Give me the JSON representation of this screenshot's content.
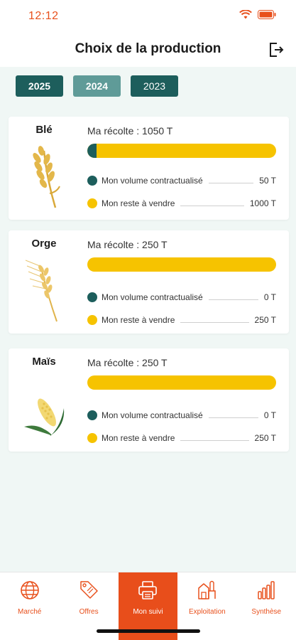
{
  "status": {
    "time": "12:12"
  },
  "header": {
    "title": "Choix de la production",
    "logout_icon": "logout-icon"
  },
  "years": [
    {
      "label": "2025",
      "active": true
    },
    {
      "label": "2024",
      "active": false
    },
    {
      "label": "2023",
      "active": false
    }
  ],
  "crops": [
    {
      "name": "Blé",
      "harvest": "Ma récolte : 1050 T",
      "contracted_label": "Mon volume contractualisé",
      "contracted_value": "50 T",
      "remaining_label": "Mon reste à vendre",
      "remaining_value": "1000 T",
      "contracted_fraction": 0.048,
      "icon": "wheat-icon"
    },
    {
      "name": "Orge",
      "harvest": "Ma récolte : 250 T",
      "contracted_label": "Mon volume contractualisé",
      "contracted_value": "0 T",
      "remaining_label": "Mon reste à vendre",
      "remaining_value": "250 T",
      "contracted_fraction": 0,
      "icon": "barley-icon"
    },
    {
      "name": "Maïs",
      "harvest": "Ma récolte : 250 T",
      "contracted_label": "Mon volume contractualisé",
      "contracted_value": "0 T",
      "remaining_label": "Mon reste à vendre",
      "remaining_value": "250 T",
      "contracted_fraction": 0,
      "icon": "corn-icon"
    }
  ],
  "nav": [
    {
      "label": "Marché",
      "icon": "globe-icon",
      "active": false
    },
    {
      "label": "Offres",
      "icon": "tag-icon",
      "active": false
    },
    {
      "label": "Mon suivi",
      "icon": "printer-icon",
      "active": true
    },
    {
      "label": "Exploitation",
      "icon": "farm-icon",
      "active": false
    },
    {
      "label": "Synthèse",
      "icon": "bar-chart-icon",
      "active": false
    }
  ],
  "colors": {
    "accent": "#e84e1b",
    "teal": "#1d5e5c",
    "yellow": "#f6c300",
    "background": "#f0f7f5"
  }
}
